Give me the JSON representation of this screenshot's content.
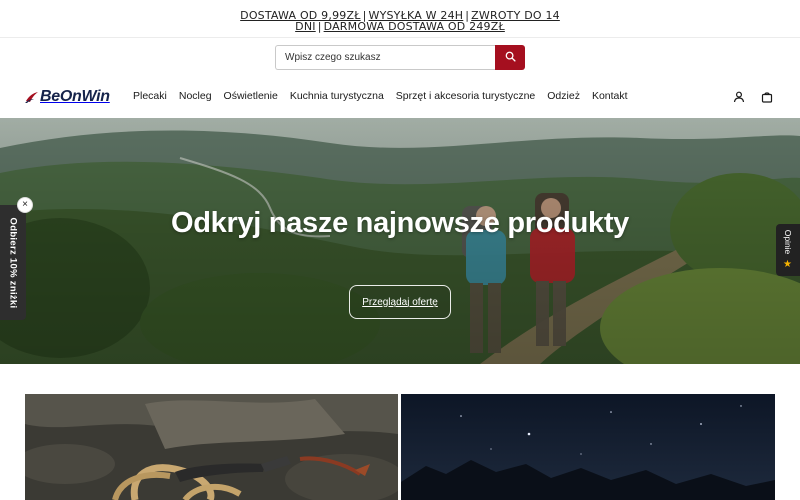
{
  "announcement": {
    "items": [
      "DOSTAWA OD 9,99ZŁ",
      "WYSYŁKA W 24H",
      "ZWROTY DO 14 DNI",
      "DARMOWA DOSTAWA OD 249ZŁ"
    ],
    "separator": "|"
  },
  "search": {
    "placeholder": "Wpisz czego szukasz",
    "button_icon": "search-icon"
  },
  "brand": {
    "name_part1": "BeOn",
    "name_part2": "Win",
    "accent_color": "#a50f1f",
    "text_color": "#15234a"
  },
  "nav": {
    "items": [
      {
        "label": "Plecaki"
      },
      {
        "label": "Nocleg"
      },
      {
        "label": "Oświetlenie"
      },
      {
        "label": "Kuchnia turystyczna"
      },
      {
        "label": "Sprzęt i akcesoria turystyczne"
      },
      {
        "label": "Odzież"
      },
      {
        "label": "Kontakt"
      }
    ]
  },
  "header_icons": {
    "account": "user-icon",
    "cart": "shopping-bag-icon"
  },
  "hero": {
    "title": "Odkryj nasze najnowsze produkty",
    "button_label": "Przeglądaj ofertę"
  },
  "side_tabs": {
    "discount_label": "Odbierz 10% zniżki",
    "close_symbol": "×",
    "reviews_label": "Opinie",
    "reviews_icon": "star-icon"
  },
  "colors": {
    "search_button": "#a50f1f",
    "tab_background": "#2e2e2e",
    "star": "#f5b301"
  }
}
